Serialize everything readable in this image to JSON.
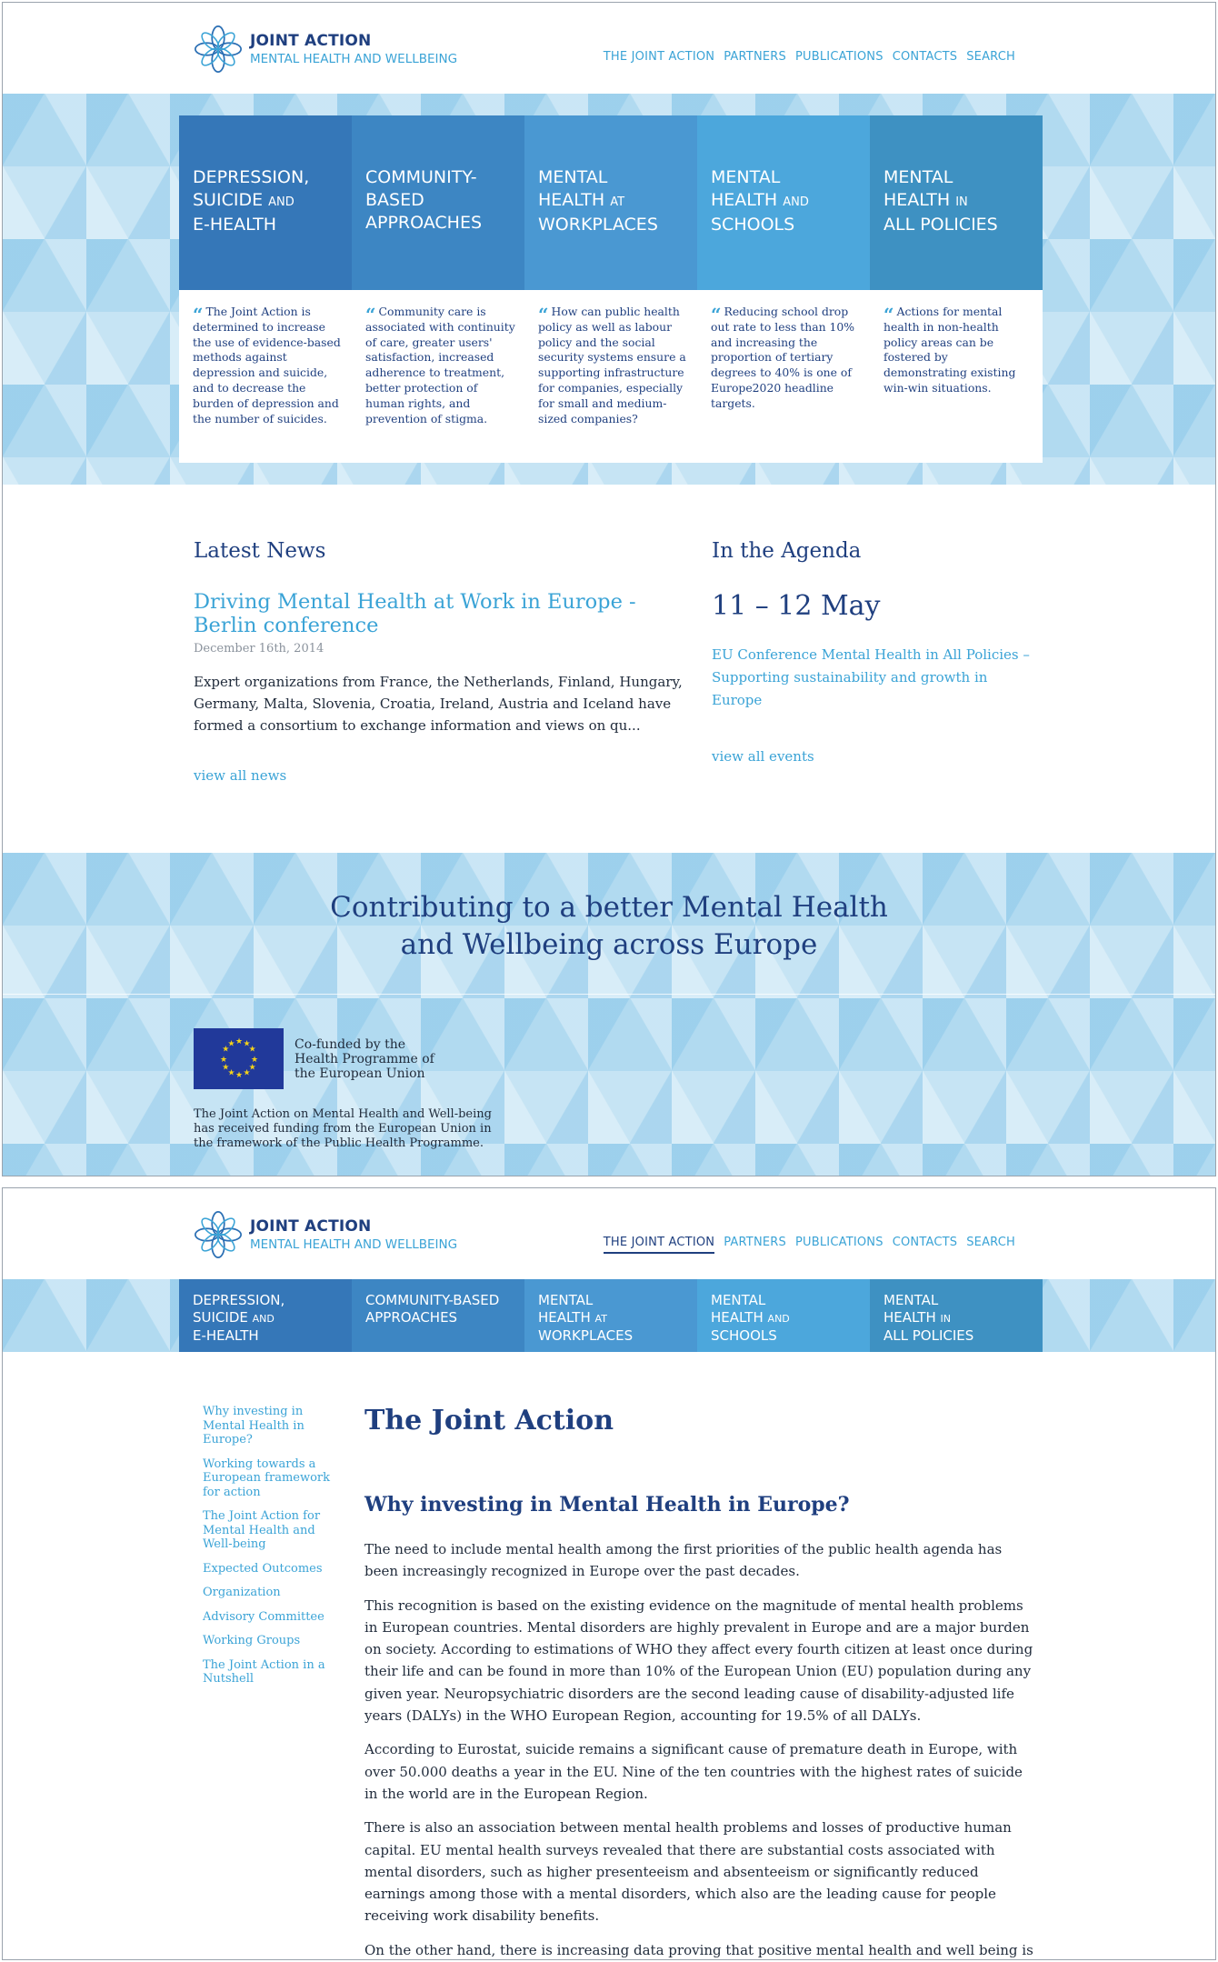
{
  "header": {
    "logo_line1": "JOINT ACTION",
    "logo_line2": "MENTAL HEALTH AND WELLBEING",
    "nav": [
      "THE JOINT ACTION",
      "PARTNERS",
      "PUBLICATIONS",
      "CONTACTS",
      "SEARCH"
    ]
  },
  "cards": [
    {
      "title_lines": [
        "DEPRESSION,",
        "SUICIDE",
        "E-HEALTH"
      ],
      "title_small": "AND",
      "text": "The Joint Action is determined to increase the use of evidence-based methods against depression and suicide, and to decrease the burden of depression and the number of suicides."
    },
    {
      "title_lines": [
        "COMMUNITY-",
        "BASED",
        "APPROACHES"
      ],
      "text": "Community care is associated with continuity of care, greater users' satisfaction, increased adherence to treatment, better protection of human rights, and prevention of stigma."
    },
    {
      "title_lines": [
        "MENTAL",
        "HEALTH",
        "WORKPLACES"
      ],
      "title_small": "AT",
      "text": "How can public health policy as well as labour policy and the social security systems ensure a supporting infrastructure for companies, especially for small and medium-sized companies?"
    },
    {
      "title_lines": [
        "MENTAL",
        "HEALTH",
        "SCHOOLS"
      ],
      "title_small": "AND",
      "text": "Reducing school drop out rate to less than 10% and increasing the proportion of tertiary degrees to 40% is one of Europe2020 headline targets."
    },
    {
      "title_lines": [
        "MENTAL",
        "HEALTH",
        "ALL POLICIES"
      ],
      "title_small": "IN",
      "text": "Actions for mental health in non-health policy areas can be fostered by demonstrating existing win-win situations."
    }
  ],
  "news": {
    "title": "Latest News",
    "headline": "Driving Mental Health at Work in Europe - Berlin conference",
    "date": "December 16th, 2014",
    "excerpt": "Expert organizations from France, the Netherlands, Finland, Hungary, Germany, Malta, Slovenia, Croatia, Ireland, Austria and Iceland have formed a consortium to exchange information and views on qu...",
    "link": "view all news"
  },
  "agenda": {
    "title": "In the Agenda",
    "date": "11 – 12 May",
    "event": "EU Conference Mental Health in All Policies – Supporting sustainability and growth in Europe",
    "link": "view all events"
  },
  "banner": {
    "line1": "Contributing to a better Mental Health",
    "line2": "and Wellbeing across Europe",
    "eu_line1": "Co-funded by the",
    "eu_line2": "Health Programme of",
    "eu_line3": "the European Union",
    "note": "The Joint Action on Mental Health and Well-being has received funding from the European Union in the framework of the Public Health Programme."
  },
  "menu2": [
    {
      "lines": [
        "DEPRESSION,",
        "SUICIDE",
        "E-HEALTH"
      ],
      "small": "AND"
    },
    {
      "lines": [
        "COMMUNITY-BASED",
        "APPROACHES"
      ]
    },
    {
      "lines": [
        "MENTAL",
        "HEALTH",
        "WORKPLACES"
      ],
      "small": "AT"
    },
    {
      "lines": [
        "MENTAL",
        "HEALTH",
        "SCHOOLS"
      ],
      "small": "AND"
    },
    {
      "lines": [
        "MENTAL",
        "HEALTH",
        "ALL POLICIES"
      ],
      "small": "IN"
    }
  ],
  "sidenav": [
    "Why investing in Mental Health in Europe?",
    "Working towards a European framework for action",
    "The Joint Action for Mental Health and Well-being",
    "Expected Outcomes",
    "Organization",
    "Advisory Committee",
    "Working Groups",
    "The Joint Action in a Nutshell"
  ],
  "content": {
    "title": "The Joint Action",
    "subtitle": "Why investing in Mental Health in Europe?",
    "paragraphs": [
      "The need to include mental health among the first priorities of the public health agenda has been increasingly recognized in Europe over the past decades.",
      "This recognition is based on the existing evidence on the magnitude of mental health problems in European countries. Mental disorders are highly prevalent in Europe and are a major burden on society. According to estimations of WHO they affect every fourth citizen at least once during their life and can be found in more than 10% of the European Union (EU) population during any given year. Neuropsychiatric disorders are the second leading cause of disability-adjusted life years (DALYs) in the WHO European Region, accounting for 19.5% of all DALYs.",
      "According to Eurostat, suicide remains a significant cause of premature death in Europe, with over 50.000 deaths a year in the EU. Nine of the ten countries with the highest rates of suicide in the world are in the European Region.",
      "There is also an association between mental health problems and losses of productive human capital. EU mental health surveys revealed that there are substantial costs associated with mental disorders, such as higher presenteeism and absenteeism or significantly reduced earnings among those with a mental disorders, which also are the leading cause for people receiving work disability benefits.",
      "On the other hand, there is increasing data proving that positive mental health and well being is a key"
    ]
  },
  "colors": {
    "dark_blue": "#1f3f7f",
    "light_blue": "#3aa3d6",
    "pattern": "#b9def2"
  }
}
